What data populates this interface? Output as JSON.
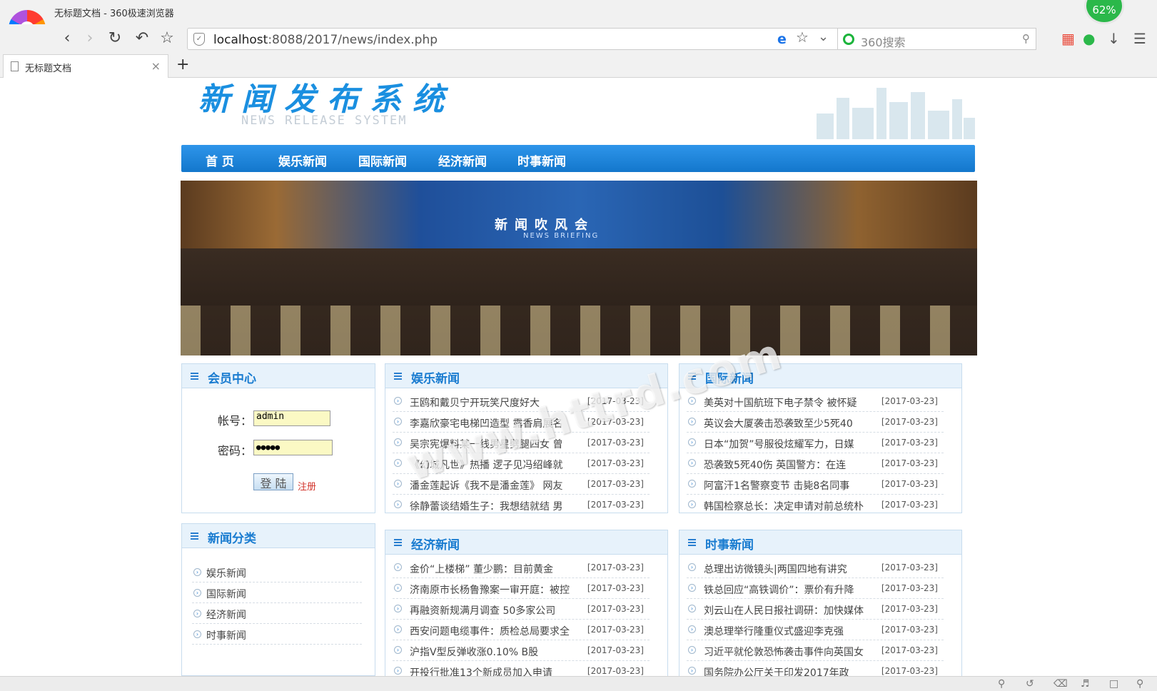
{
  "browser": {
    "window_title": "无标题文档 - 360极速浏览器",
    "badge": "62%",
    "url_host": "localhost",
    "url_rest": ":8088/2017/news/index.php",
    "search_placeholder": "360搜索",
    "tab_label": "无标题文档",
    "tab_close": "×",
    "new_tab": "+"
  },
  "site": {
    "title": "新闻发布系统",
    "subtitle": "NEWS RELEASE SYSTEM",
    "nav": [
      "首 页",
      "娱乐新闻",
      "国际新闻",
      "经济新闻",
      "时事新闻"
    ],
    "banner_text": "新闻吹风会",
    "banner_en": "NEWS BRIEFING",
    "watermark": "www.httrd.com"
  },
  "login": {
    "title": "会员中心",
    "account_label": "帐号：",
    "account_value": "admin",
    "password_label": "密码：",
    "password_value": "●●●●●",
    "login_button": "登 陆",
    "register_link": "注册"
  },
  "categories": {
    "title": "新闻分类",
    "items": [
      "娱乐新闻",
      "国际新闻",
      "经济新闻",
      "时事新闻"
    ]
  },
  "entertainment": {
    "title": "娱乐新闻",
    "items": [
      {
        "title": "王鸥和戴贝宁开玩笑尺度好大",
        "date": "[2017-03-23]"
      },
      {
        "title": "李嘉欣豪宅电梯凹造型 露香肩展名",
        "date": "[2017-03-23]"
      },
      {
        "title": "吴宗宪爆料某一线男星劈腿四女 曾",
        "date": "[2017-03-23]"
      },
      {
        "title": "《幻城凡世》热播 逻子见冯绍峰就",
        "date": "[2017-03-23]"
      },
      {
        "title": "潘金莲起诉《我不是潘金莲》 网友",
        "date": "[2017-03-23]"
      },
      {
        "title": "徐静蕾谈结婚生子：我想结就结 男",
        "date": "[2017-03-23]"
      }
    ]
  },
  "international": {
    "title": "国际新闻",
    "items": [
      {
        "title": "美英对十国航班下电子禁令 被怀疑",
        "date": "[2017-03-23]"
      },
      {
        "title": "英议会大厦袭击恐袭致至少5死40",
        "date": "[2017-03-23]"
      },
      {
        "title": "日本“加贺”号服役炫耀军力，日媒",
        "date": "[2017-03-23]"
      },
      {
        "title": "恐袭致5死40伤 英国警方：在连",
        "date": "[2017-03-23]"
      },
      {
        "title": "阿富汗1名警察变节 击毙8名同事",
        "date": "[2017-03-23]"
      },
      {
        "title": "韩国检察总长：决定申请对前总统朴",
        "date": "[2017-03-23]"
      }
    ]
  },
  "economy": {
    "title": "经济新闻",
    "items": [
      {
        "title": "金价“上楼梯” 董少鹏：目前黄金",
        "date": "[2017-03-23]"
      },
      {
        "title": "济南原市长杨鲁豫案一审开庭：被控",
        "date": "[2017-03-23]"
      },
      {
        "title": "再融资新规满月调查 50多家公司",
        "date": "[2017-03-23]"
      },
      {
        "title": "西安问题电缆事件：质检总局要求全",
        "date": "[2017-03-23]"
      },
      {
        "title": "沪指V型反弹收涨0.10% B股",
        "date": "[2017-03-23]"
      },
      {
        "title": "开投行批准13个新成员加入申请",
        "date": "[2017-03-23]"
      }
    ]
  },
  "current": {
    "title": "时事新闻",
    "items": [
      {
        "title": "总理出访微镜头|两国四地有讲究",
        "date": "[2017-03-23]"
      },
      {
        "title": "铁总回应“高铁调价”：票价有升降",
        "date": "[2017-03-23]"
      },
      {
        "title": "刘云山在人民日报社调研：加快媒体",
        "date": "[2017-03-23]"
      },
      {
        "title": "澳总理举行隆重仪式盛迎李克强",
        "date": "[2017-03-23]"
      },
      {
        "title": "习近平就伦敦恐怖袭击事件向英国女",
        "date": "[2017-03-23]"
      },
      {
        "title": "国务院办公厅关于印发2017年政",
        "date": "[2017-03-23]"
      }
    ]
  },
  "icons": [
    "back-icon",
    "forward-icon",
    "reload-icon",
    "undo-icon",
    "star-icon",
    "shield-icon",
    "ie-icon",
    "dropdown-icon",
    "search-icon",
    "apps-icon",
    "download-icon",
    "menu-icon",
    "document-icon",
    "list-icon",
    "arrow-icon"
  ]
}
